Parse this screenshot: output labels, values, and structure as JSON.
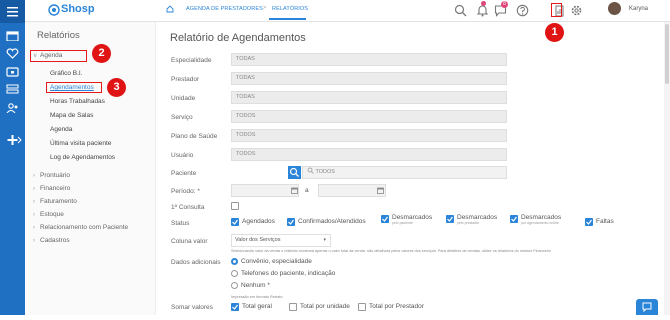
{
  "app": {
    "logo_text": "Shosp",
    "brand_color": "#2a84d8",
    "accent_red": "#e01414"
  },
  "breadcrumb": {
    "home_icon": "home-icon",
    "items": [
      "AGENDA DE PRESTADORES",
      "RELATÓRIOS"
    ],
    "separator": ">"
  },
  "topbar": {
    "icons": [
      "search-icon",
      "bell-icon",
      "chat-icon",
      "help-icon",
      "reports-icon",
      "gear-icon"
    ],
    "chat_badge": "8",
    "user_name": "Karyna"
  },
  "steps": [
    "1",
    "2",
    "3"
  ],
  "sidebar": {
    "title": "Relatórios",
    "open_group": "Agenda",
    "agenda_items": [
      "Gráfico B.I.",
      "Agendamentos",
      "Horas Trabalhadas",
      "Mapa de Salas",
      "Agenda",
      "Última visita paciente",
      "Log de Agendamentos"
    ],
    "groups": [
      "Prontuário",
      "Financeiro",
      "Faturamento",
      "Estoque",
      "Relacionamento com Paciente",
      "Cadastros"
    ]
  },
  "main": {
    "title": "Relatório de Agendamentos",
    "fields": [
      {
        "label": "Especialidade",
        "value": "TODAS"
      },
      {
        "label": "Prestador",
        "value": "TODAS"
      },
      {
        "label": "Unidade",
        "value": "TODAS"
      },
      {
        "label": "Serviço",
        "value": "TODOS"
      },
      {
        "label": "Plano de Saúde",
        "value": "TODOS"
      },
      {
        "label": "Usuário",
        "value": "TODOS"
      }
    ],
    "paciente": {
      "label": "Paciente",
      "value": "TODOS"
    },
    "periodo": {
      "label": "Período: *",
      "separator": "a"
    },
    "primeira_consulta": {
      "label": "1ª Consulta"
    },
    "status": {
      "label": "Status",
      "options": [
        {
          "text": "Agendados",
          "note": ""
        },
        {
          "text": "Confirmados/Atendidos",
          "note": ""
        },
        {
          "text": "Desmarcados",
          "note": "pelo paciente"
        },
        {
          "text": "Desmarcados",
          "note": "pelo prestador"
        },
        {
          "text": "Desmarcados",
          "note": "por agendamento online"
        },
        {
          "text": "Faltas",
          "note": ""
        }
      ]
    },
    "coluna_valor": {
      "label": "Coluna valor",
      "selected": "Valor dos Serviços",
      "hint": "Selecionando valor da venda o relatório mostrará apenas o valor total da venda, não detalhará pelos valores dos serviços. Para detalhes de vendas, utilize os relatórios do módulo Financeiro"
    },
    "dados_adicionais": {
      "label": "Dados adicionais",
      "options": [
        "Convênio, especialidade",
        "Telefones do paciente, indicação",
        "Nenhum *"
      ]
    },
    "somar_valores": {
      "label": "Somar valores",
      "hint": "Impressão em formato Retrato",
      "options": [
        "Total geral",
        "Total por unidade",
        "Total por Prestador"
      ]
    }
  }
}
